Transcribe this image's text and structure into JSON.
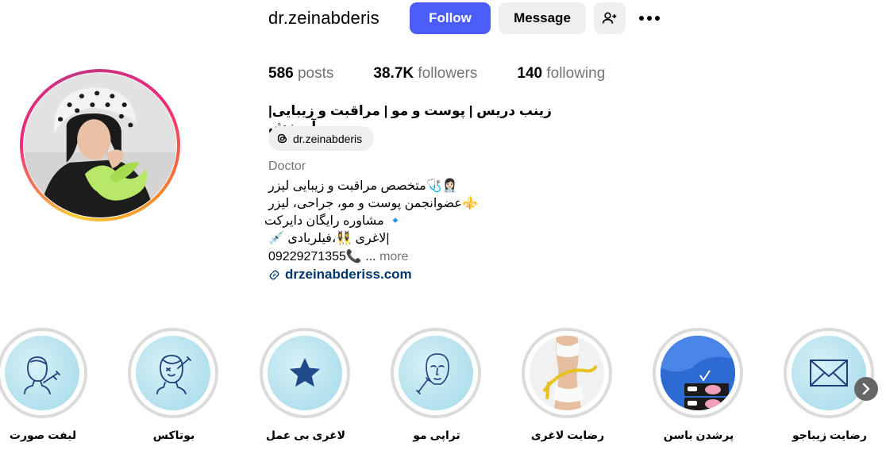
{
  "profile": {
    "username": "dr.zeinabderis",
    "follow_label": "Follow",
    "message_label": "Message",
    "stats": {
      "posts_count": "586",
      "posts_label": "posts",
      "followers_count": "38.7K",
      "followers_label": "followers",
      "following_count": "140",
      "following_label": "following"
    },
    "full_name": "زینب دریس | پوست و مو | مراقبت و زیبایی| آموزش",
    "threads_handle": "dr.zeinabderis",
    "category": "Doctor",
    "bio_lines": [
      "👩🏻‍⚕️🩺متخصص مراقبت و زیبایی لیزر",
      "⚜️عضوانجمن پوست و مو، جراحی، لیزر",
      "🔹 مشاوره رایگان دایرکت",
      "|لاغری 👯‍♀️،فیلربادی 💉"
    ],
    "phone_line": "09229271355📞",
    "ellipsis": "...",
    "more_label": "more",
    "website": "drzeinabderiss.com"
  },
  "highlights": [
    {
      "label": "لیفت صورت",
      "icon": "face-thread-lift-icon"
    },
    {
      "label": "بوتاکس",
      "icon": "botox-injection-icon"
    },
    {
      "label": "لاغری بی عمل",
      "icon": "star-icon"
    },
    {
      "label": "تراپی مو",
      "icon": "face-injection-icon"
    },
    {
      "label": "رضایت لاغری",
      "icon": "body-measure-photo"
    },
    {
      "label": "پرشدن باسن",
      "icon": "before-after-photo"
    },
    {
      "label": "رضایت زیباجو",
      "icon": "envelope-icon"
    }
  ],
  "colors": {
    "follow_button": "#4a5df9",
    "secondary_button": "#efefef",
    "link": "#00376b",
    "muted_text": "#737373",
    "highlight_cover": "#b6e2ee"
  }
}
